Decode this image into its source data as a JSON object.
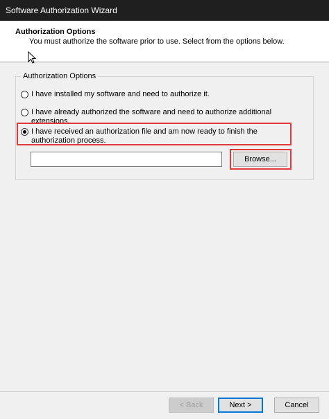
{
  "window": {
    "title": "Software Authorization Wizard"
  },
  "header": {
    "title": "Authorization Options",
    "subtitle": "You must authorize the software prior to use. Select from the options below."
  },
  "group": {
    "legend": "Authorization Options",
    "options": [
      {
        "label": "I have installed my software and need to authorize it.",
        "selected": false
      },
      {
        "label": "I have already authorized the software and need to authorize additional extensions.",
        "selected": false
      },
      {
        "label": "I have received an authorization file and am now ready to finish the authorization process.",
        "selected": true
      }
    ],
    "file_path": "",
    "browse_label": "Browse..."
  },
  "footer": {
    "back_label": "< Back",
    "next_label": "Next >",
    "cancel_label": "Cancel"
  },
  "colors": {
    "highlight": "#e03a3a",
    "titlebar": "#1f1f1f",
    "accent": "#0078d7"
  }
}
